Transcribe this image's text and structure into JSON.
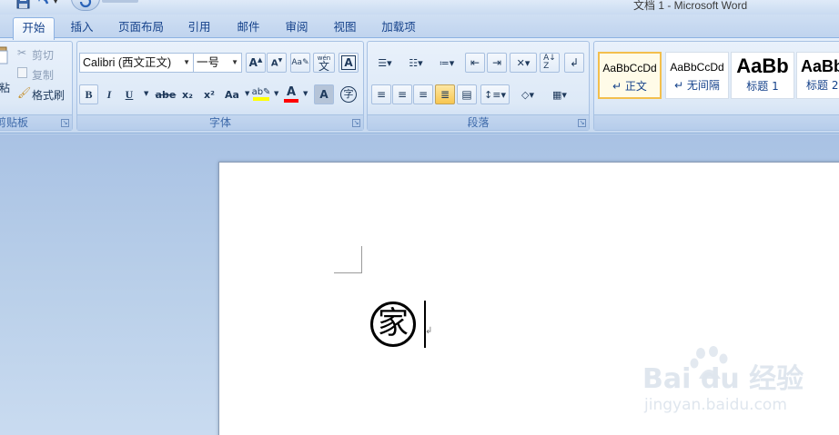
{
  "window": {
    "title": "文档 1 - Microsoft Word"
  },
  "tabs": [
    {
      "label": "开始",
      "active": true
    },
    {
      "label": "插入"
    },
    {
      "label": "页面布局"
    },
    {
      "label": "引用"
    },
    {
      "label": "邮件"
    },
    {
      "label": "审阅"
    },
    {
      "label": "视图"
    },
    {
      "label": "加载项"
    }
  ],
  "clipboard": {
    "paste_label": "粘",
    "cut_label": "剪切",
    "copy_label": "复制",
    "format_painter_label": "格式刷",
    "group_label": "剪贴板"
  },
  "font": {
    "font_name": "Calibri (西文正文)",
    "font_size": "一号",
    "group_label": "字体",
    "bold": "B",
    "italic": "I",
    "underline": "U",
    "strikethrough": "abe",
    "subscript": "x₂",
    "superscript": "x²",
    "change_case": "Aa",
    "clear_format": "A",
    "char_shading": "A",
    "enclose_char": "字",
    "phonetic": "wén",
    "char_border": "A"
  },
  "paragraph": {
    "group_label": "段落"
  },
  "styles": [
    {
      "sample": "AaBbCcDd",
      "name": "正文",
      "selected": true
    },
    {
      "sample": "AaBbCcDd",
      "name": "无间隔"
    },
    {
      "sample": "AaBb",
      "name": "标题 1"
    },
    {
      "sample": "AaBb",
      "name": "标题 2"
    }
  ],
  "document": {
    "enclosed_char": "家"
  },
  "watermark": {
    "brand": "Bai du 经验",
    "url": "jingyan.baidu.com"
  },
  "colors": {
    "highlight": "#ffff00",
    "font_color": "#ff0000",
    "selected_style_border": "#f3bf4d"
  }
}
